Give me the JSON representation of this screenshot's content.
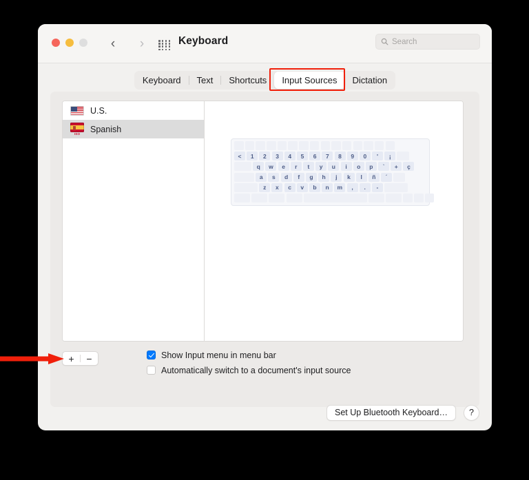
{
  "window": {
    "title": "Keyboard",
    "traffic_lights": [
      "close",
      "minimize",
      "zoom"
    ],
    "nav": {
      "back": "‹",
      "forward": "›"
    },
    "grid_icon": "app-grid-icon"
  },
  "search": {
    "placeholder": "Search",
    "value": ""
  },
  "tabs": [
    {
      "label": "Keyboard",
      "active": false
    },
    {
      "label": "Text",
      "active": false
    },
    {
      "label": "Shortcuts",
      "active": false
    },
    {
      "label": "Input Sources",
      "active": true
    },
    {
      "label": "Dictation",
      "active": false
    }
  ],
  "input_sources": [
    {
      "label": "U.S.",
      "flag": "us",
      "iso": "",
      "selected": false
    },
    {
      "label": "Spanish",
      "flag": "es",
      "iso": "ISO",
      "selected": true
    }
  ],
  "keyboard_preview": {
    "layout_name": "Spanish ISO",
    "rows": [
      [
        "",
        "",
        "",
        "",
        "",
        "",
        "",
        "",
        "",
        "",
        "",
        "",
        "",
        "",
        ""
      ],
      [
        "<",
        "1",
        "2",
        "3",
        "4",
        "5",
        "6",
        "7",
        "8",
        "9",
        "0",
        "'",
        "¡",
        ""
      ],
      [
        "",
        "q",
        "w",
        "e",
        "r",
        "t",
        "y",
        "u",
        "i",
        "o",
        "p",
        "`",
        "+",
        "ç"
      ],
      [
        "",
        "a",
        "s",
        "d",
        "f",
        "g",
        "h",
        "j",
        "k",
        "l",
        "ñ",
        "´",
        ""
      ],
      [
        "",
        "z",
        "x",
        "c",
        "v",
        "b",
        "n",
        "m",
        ",",
        ".",
        "-",
        ""
      ],
      [
        "",
        "",
        "",
        "",
        "",
        "",
        "",
        "",
        "",
        ""
      ]
    ]
  },
  "list_controls": {
    "add_label": "+",
    "remove_label": "−"
  },
  "checkboxes": [
    {
      "label": "Show Input menu in menu bar",
      "checked": true
    },
    {
      "label": "Automatically switch to a document's input source",
      "checked": false
    }
  ],
  "footer": {
    "bluetooth_button": "Set Up Bluetooth Keyboard…",
    "help_button": "?"
  },
  "annotations": {
    "highlight_target": "Input Sources",
    "arrow_target": "add-remove-input-source-buttons",
    "color": "#f01f0a"
  }
}
